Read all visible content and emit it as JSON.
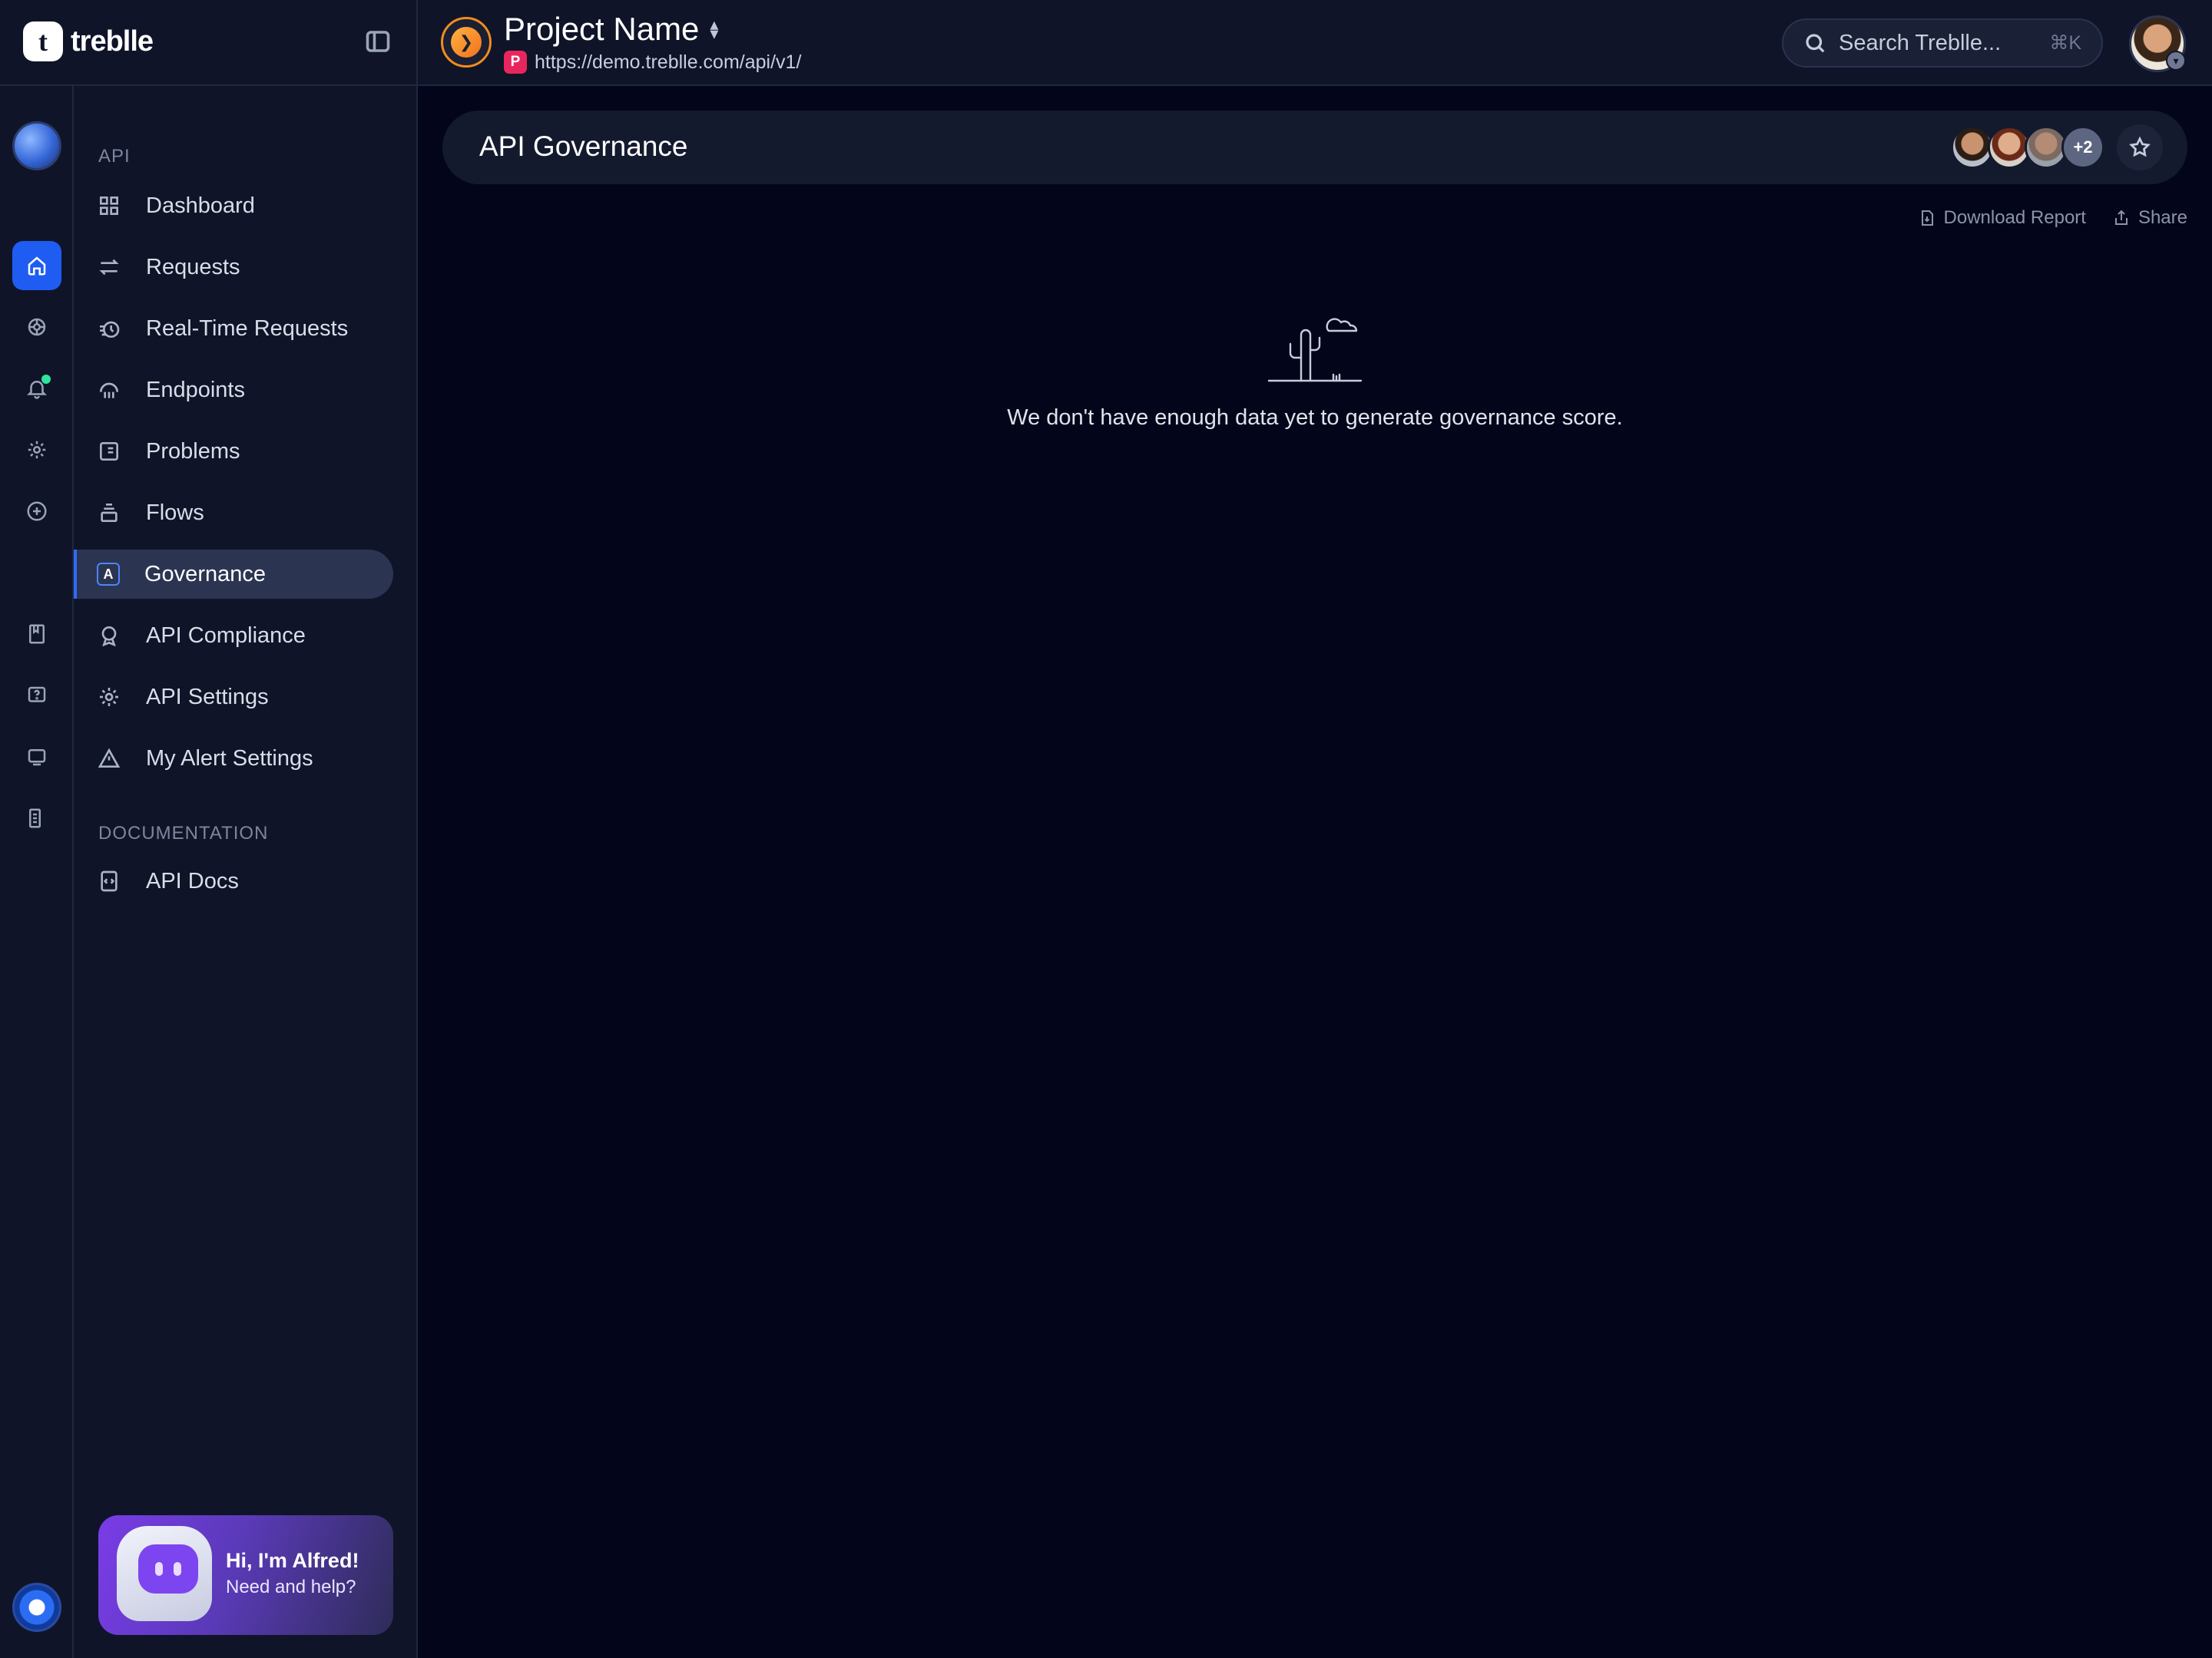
{
  "brand": {
    "name": "treblle",
    "mark": "t"
  },
  "project": {
    "name": "Project Name",
    "url": "https://demo.treblle.com/api/v1/",
    "badge": "P"
  },
  "search": {
    "placeholder": "Search Treblle...",
    "shortcut": "⌘K"
  },
  "rail": {
    "items": [
      {
        "name": "workspace-avatar"
      },
      {
        "name": "home-icon",
        "active": true
      },
      {
        "name": "brain-icon"
      },
      {
        "name": "bell-icon",
        "has_notification": true
      },
      {
        "name": "gear-icon"
      },
      {
        "name": "plus-circle-icon"
      },
      {
        "name": "book-icon"
      },
      {
        "name": "help-icon"
      },
      {
        "name": "chat-icon"
      },
      {
        "name": "apps-icon"
      }
    ]
  },
  "sidebar": {
    "section_api": "API",
    "items": [
      {
        "label": "Dashboard",
        "icon": "grid-icon"
      },
      {
        "label": "Requests",
        "icon": "arrows-icon"
      },
      {
        "label": "Real-Time Requests",
        "icon": "realtime-icon"
      },
      {
        "label": "Endpoints",
        "icon": "endpoints-icon"
      },
      {
        "label": "Problems",
        "icon": "list-icon"
      },
      {
        "label": "Flows",
        "icon": "stack-icon"
      },
      {
        "label": "Governance",
        "icon": "governance-icon",
        "active": true
      },
      {
        "label": "API Compliance",
        "icon": "badge-icon"
      },
      {
        "label": "API Settings",
        "icon": "gear-icon"
      },
      {
        "label": "My Alert Settings",
        "icon": "warning-icon"
      }
    ],
    "section_docs": "DOCUMENTATION",
    "docs_items": [
      {
        "label": "API Docs",
        "icon": "code-doc-icon"
      }
    ],
    "alfred": {
      "title": "Hi, I'm Alfred!",
      "subtitle": "Need and help?"
    }
  },
  "main": {
    "title": "API Governance",
    "collaborators_more": "+2",
    "actions": {
      "download": "Download Report",
      "share": "Share"
    },
    "empty_message": "We don't have enough data yet to generate governance score."
  },
  "colors": {
    "accent": "#1f5cf2",
    "background": "#03061a",
    "panel": "#0f1428",
    "notification": "#2ee59d",
    "project_badge": "#e8265e"
  }
}
